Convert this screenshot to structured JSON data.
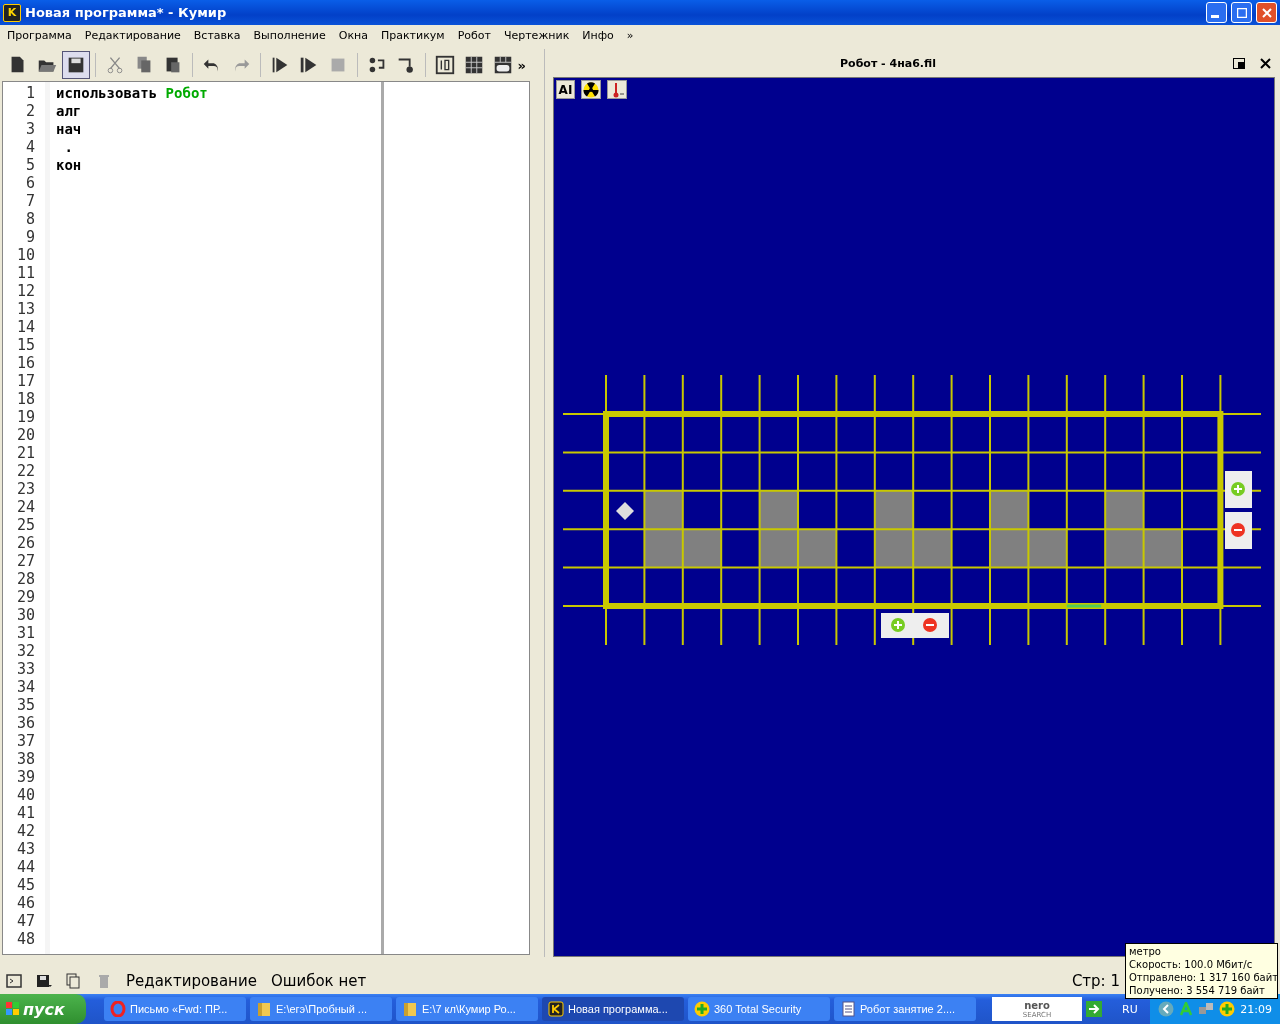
{
  "window": {
    "title": "Новая программа* - Кумир",
    "app_icon": "K"
  },
  "menu": [
    "Программа",
    "Редактирование",
    "Вставка",
    "Выполнение",
    "Окна",
    "Практикум",
    "Робот",
    "Чертежник",
    "Инфо",
    "»"
  ],
  "toolbar": {
    "overflow": "»"
  },
  "editor": {
    "lines": [
      {
        "parts": [
          {
            "text": "использовать",
            "kind": "keyword"
          },
          {
            "text": "Робот",
            "kind": "module"
          }
        ]
      },
      {
        "parts": [
          {
            "text": "алг",
            "kind": "keyword"
          }
        ]
      },
      {
        "parts": [
          {
            "text": "нач",
            "kind": "keyword"
          }
        ]
      },
      {
        "parts": [
          {
            "text": " .",
            "kind": "plain"
          }
        ]
      },
      {
        "parts": [
          {
            "text": "кон",
            "kind": "keyword"
          }
        ]
      }
    ],
    "line_count_numbers": [
      "1",
      "2",
      "3",
      "4",
      "5",
      "6",
      "7",
      "8",
      "9",
      "10",
      "11",
      "12",
      "13",
      "14",
      "15",
      "16",
      "17",
      "18",
      "19",
      "20",
      "21",
      "22",
      "23",
      "24",
      "25",
      "26",
      "27",
      "28",
      "29",
      "30",
      "31",
      "32",
      "33",
      "34",
      "35",
      "36",
      "37",
      "38",
      "39",
      "40",
      "41",
      "42",
      "43",
      "44",
      "45",
      "46",
      "47",
      "48"
    ]
  },
  "robot_window": {
    "title": "Робот - 4на6.fil",
    "tool_label": "AI"
  },
  "status_bar": {
    "mode": "Редактирование",
    "errors": "Ошибок нет",
    "position": "Стр: 1"
  },
  "tooltip": [
    "метро",
    "Скорость: 100.0 Мбит/с",
    "Отправлено: 1 317 160 байт",
    "Получено: 3 554 719 байт"
  ],
  "taskbar": {
    "start": "пуск",
    "tasks": [
      {
        "label": "Письмо «Fwd: ПР...",
        "kind": "browser",
        "selected": false
      },
      {
        "label": "E:\\егэ\\Пробный ...",
        "kind": "folder",
        "selected": false
      },
      {
        "label": "E:\\7 кл\\Кумир Ро...",
        "kind": "folder",
        "selected": false
      },
      {
        "label": "Новая программа...",
        "kind": "kumir",
        "selected": true
      },
      {
        "label": "360 Total Security",
        "kind": "shield",
        "selected": false
      },
      {
        "label": "Робот занятие 2....",
        "kind": "word",
        "selected": false
      }
    ],
    "search_logo": "nero",
    "search_sub": "SEARCH",
    "language": "RU",
    "clock": "21:09"
  }
}
